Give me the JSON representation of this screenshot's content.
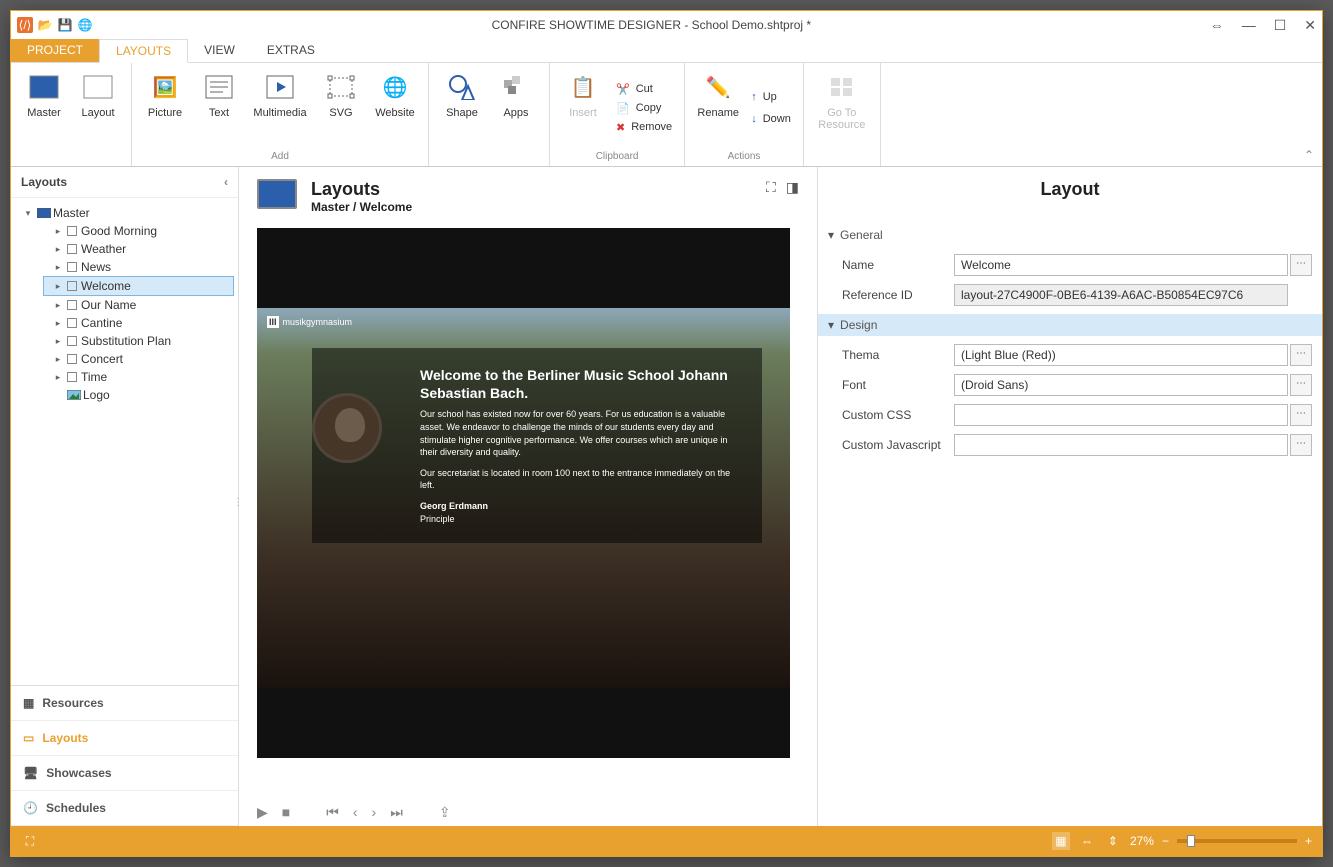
{
  "window_title": "CONFIRE SHOWTIME DESIGNER - School Demo.shtproj *",
  "menu_tabs": {
    "project": "PROJECT",
    "layouts": "LAYOUTS",
    "view": "VIEW",
    "extras": "EXTRAS"
  },
  "ribbon": {
    "master": "Master",
    "layout": "Layout",
    "picture": "Picture",
    "text": "Text",
    "multimedia": "Multimedia",
    "svg": "SVG",
    "website": "Website",
    "shape": "Shape",
    "apps": "Apps",
    "insert": "Insert",
    "cut": "Cut",
    "copy": "Copy",
    "remove": "Remove",
    "rename": "Rename",
    "up": "Up",
    "down": "Down",
    "goto": "Go To Resource",
    "group_add": "Add",
    "group_clipboard": "Clipboard",
    "group_actions": "Actions"
  },
  "sidebar": {
    "header": "Layouts",
    "root": "Master",
    "items": [
      "Good Morning",
      "Weather",
      "News",
      "Welcome",
      "Our Name",
      "Cantine",
      "Substitution Plan",
      "Concert",
      "Time",
      "Logo"
    ],
    "selected_index": 3,
    "nav": {
      "resources": "Resources",
      "layouts": "Layouts",
      "showcases": "Showcases",
      "schedules": "Schedules"
    }
  },
  "center": {
    "title": "Layouts",
    "breadcrumb": "Master / Welcome",
    "scene": {
      "logo": "musikgymnasium",
      "heading": "Welcome to the Berliner Music School Johann Sebastian Bach.",
      "p1": "Our school has existed now for over 60 years. For us education is a valuable asset. We endeavor to challenge the minds of our students every day and stimulate higher cognitive performance. We offer courses which are unique in their diversity and quality.",
      "p2": "Our secretariat is located in room 100 next to the entrance immediately on the left.",
      "sig_name": "Georg Erdmann",
      "sig_role": "Principle"
    }
  },
  "right": {
    "title": "Layout",
    "general": "General",
    "design": "Design",
    "fields": {
      "name_label": "Name",
      "name_value": "Welcome",
      "ref_label": "Reference ID",
      "ref_value": "layout-27C4900F-0BE6-4139-A6AC-B50854EC97C6",
      "thema_label": "Thema",
      "thema_value": "(Light Blue (Red))",
      "font_label": "Font",
      "font_value": "(Droid Sans)",
      "css_label": "Custom CSS",
      "css_value": "",
      "js_label": "Custom Javascript",
      "js_value": ""
    }
  },
  "status": {
    "zoom": "27%"
  }
}
